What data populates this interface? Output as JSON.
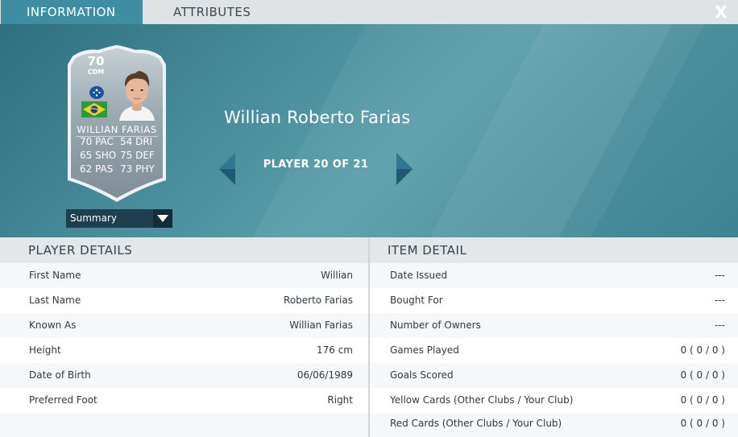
{
  "tabs": {
    "information": "INFORMATION",
    "attributes": "ATTRIBUTES",
    "close": "X"
  },
  "card": {
    "rating": "70",
    "position": "CDM",
    "name": "WILLIAN FARIAS",
    "stats": {
      "pac": "70 PAC",
      "dri": "54 DRI",
      "sho": "65 SHO",
      "def": "75 DEF",
      "pas": "62 PAS",
      "phy": "73 PHY"
    },
    "colors": {
      "card": "#8e9ca4",
      "card_light": "#b9c4ca"
    },
    "icons": {
      "club": "club-crest-icon",
      "flag": "brazil-flag-icon"
    }
  },
  "summary_dropdown": {
    "selected": "Summary"
  },
  "player": {
    "full_name": "Willian Roberto Farias",
    "count": "PLAYER 20 OF 21"
  },
  "player_details": {
    "heading": "PLAYER DETAILS",
    "rows": [
      {
        "label": "First Name",
        "value": "Willian"
      },
      {
        "label": "Last Name",
        "value": "Roberto Farias"
      },
      {
        "label": "Known As",
        "value": "Willian Farias"
      },
      {
        "label": "Height",
        "value": "176 cm"
      },
      {
        "label": "Date of Birth",
        "value": "06/06/1989"
      },
      {
        "label": "Preferred Foot",
        "value": "Right"
      }
    ]
  },
  "item_detail": {
    "heading": "ITEM DETAIL",
    "rows": [
      {
        "label": "Date Issued",
        "value": "---"
      },
      {
        "label": "Bought For",
        "value": "---"
      },
      {
        "label": "Number of Owners",
        "value": "---"
      },
      {
        "label": "Games Played",
        "value": "0 ( 0 / 0 )"
      },
      {
        "label": "Goals Scored",
        "value": "0 ( 0 / 0 )"
      },
      {
        "label": "Yellow Cards (Other Clubs / Your Club)",
        "value": "0 ( 0 / 0 )"
      },
      {
        "label": "Red Cards (Other Clubs / Your Club)",
        "value": "0 ( 0 / 0 )"
      }
    ]
  },
  "colors": {
    "tab_active": "#3f8da3",
    "hero": "#4a8e9d",
    "dropdown": "#1f3e4f"
  }
}
